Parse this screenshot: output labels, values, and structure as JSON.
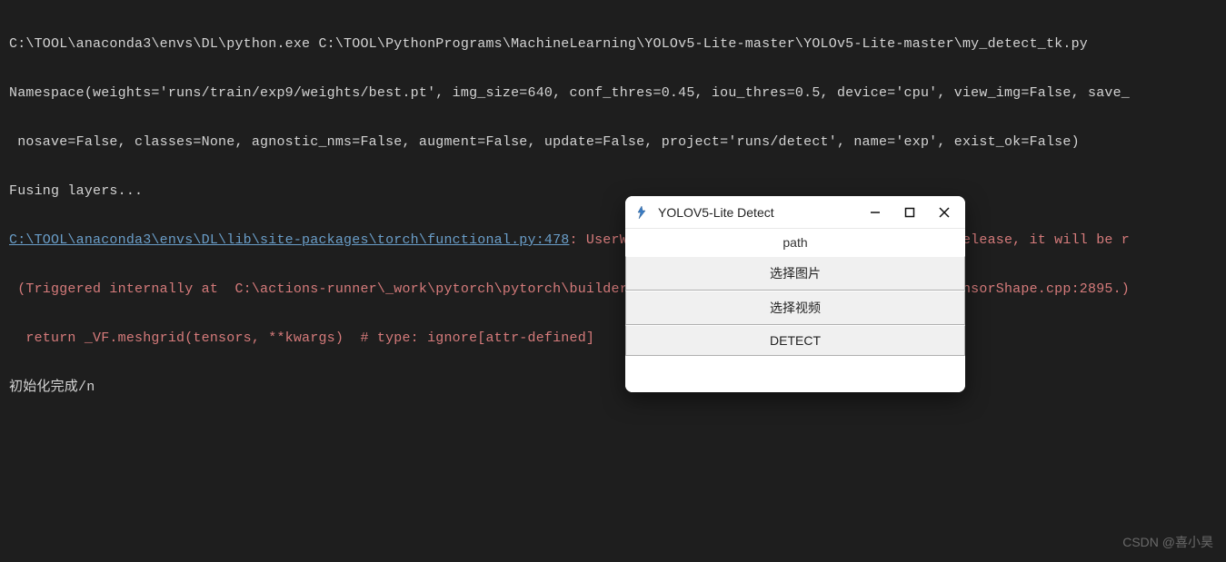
{
  "console": {
    "line1": "C:\\TOOL\\anaconda3\\envs\\DL\\python.exe C:\\TOOL\\PythonPrograms\\MachineLearning\\YOLOv5-Lite-master\\YOLOv5-Lite-master\\my_detect_tk.py",
    "line2": "Namespace(weights='runs/train/exp9/weights/best.pt', img_size=640, conf_thres=0.45, iou_thres=0.5, device='cpu', view_img=False, save_",
    "line3": " nosave=False, classes=None, agnostic_nms=False, augment=False, update=False, project='runs/detect', name='exp', exist_ok=False)",
    "line4": "Fusing layers... ",
    "link_path": "C:\\TOOL\\anaconda3\\envs\\DL\\lib\\site-packages\\torch\\functional.py:478",
    "warn_tail1": ": UserWarning: torch.meshgrid: in an upcoming release, it will be r",
    "line6": " (Triggered internally at  C:\\actions-runner\\_work\\pytorch\\pytorch\\builder\\windows\\pytorch\\aten\\src\\ATen\\native\\TensorShape.cpp:2895.)",
    "line7": "  return _VF.meshgrid(tensors, **kwargs)  # type: ignore[attr-defined]",
    "line8": "初始化完成/n"
  },
  "window": {
    "title": "YOLOV5-Lite Detect",
    "path_label": "path",
    "btn_image": "选择图片",
    "btn_video": "选择视频",
    "btn_detect": "DETECT"
  },
  "watermark": "CSDN @喜小昊"
}
